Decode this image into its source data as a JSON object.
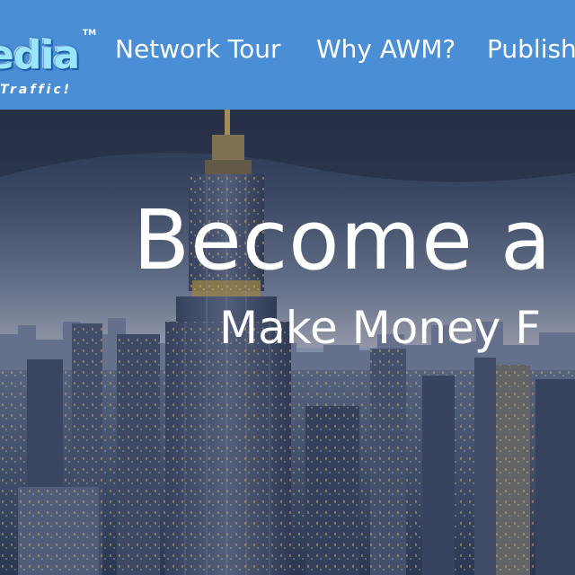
{
  "header": {
    "logo": {
      "word": "edia",
      "tagline": "Traffic!",
      "trademark": "TM"
    },
    "nav": [
      {
        "label": "Network Tour"
      },
      {
        "label": "Why AWM?"
      },
      {
        "label": "Publish"
      }
    ]
  },
  "hero": {
    "title": "Become a",
    "subtitle": "Make Money F"
  },
  "colors": {
    "header_bg": "#4a8fd6",
    "text": "#ffffff"
  }
}
